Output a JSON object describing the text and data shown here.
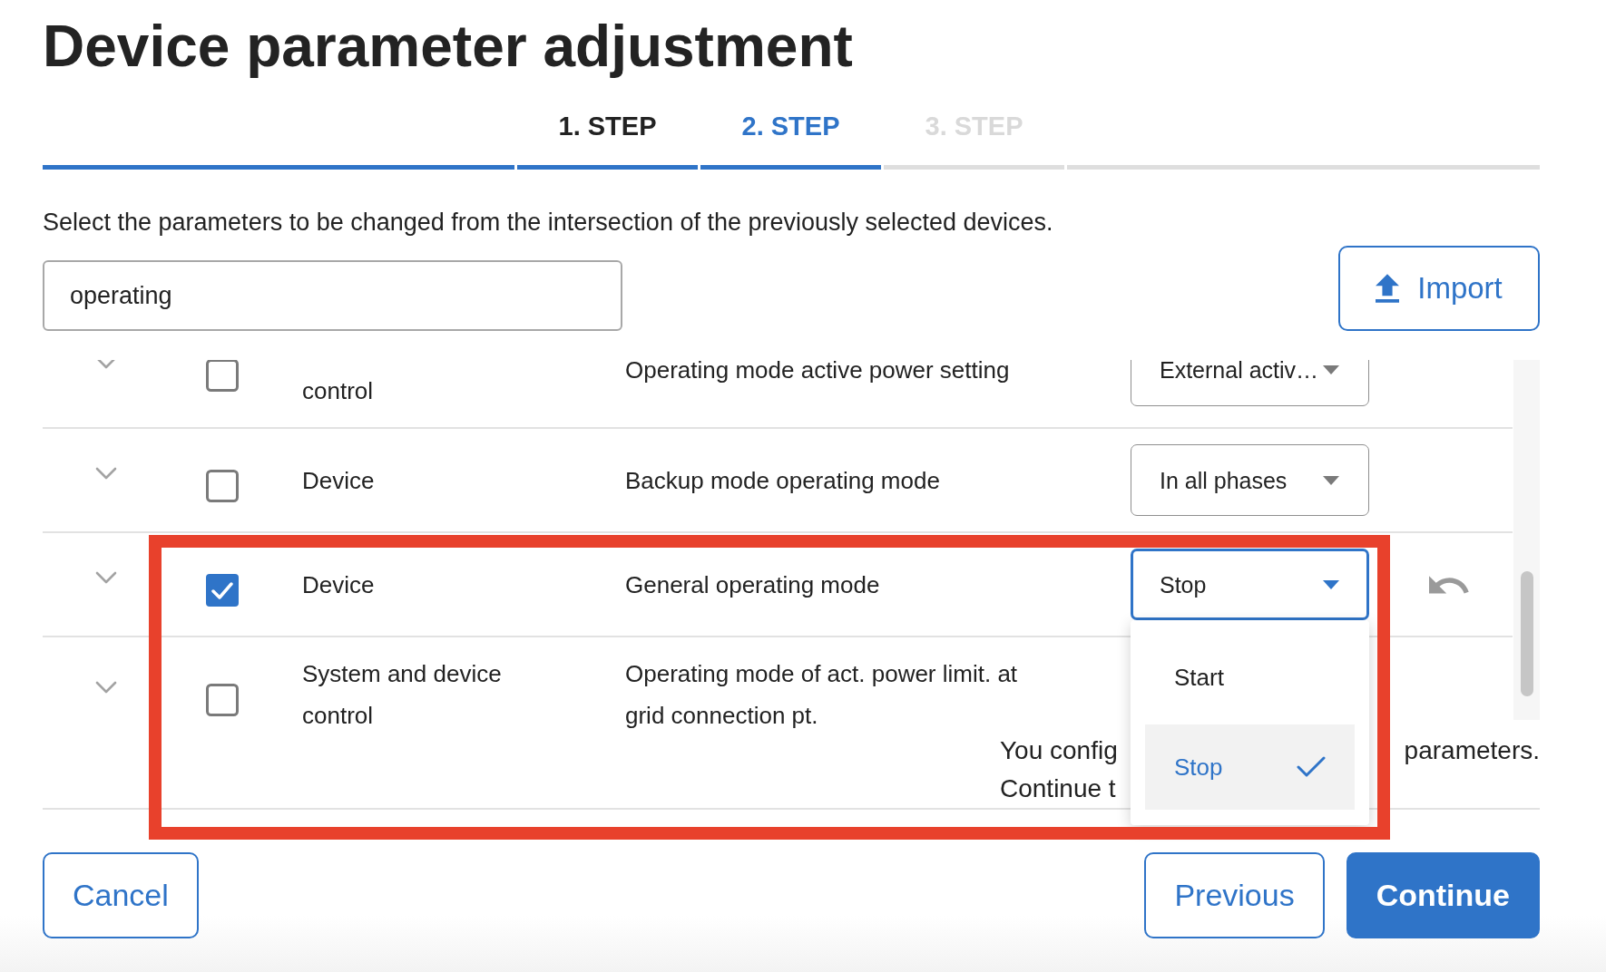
{
  "title": "Device parameter adjustment",
  "steps": [
    {
      "label": "1. STEP",
      "completed": true,
      "selected": false
    },
    {
      "label": "2. STEP",
      "completed": false,
      "selected": true
    },
    {
      "label": "3. STEP",
      "completed": false,
      "selected": false
    }
  ],
  "instruction": "Select the parameters to be changed from the intersection of the previously selected devices.",
  "search": {
    "value": "operating"
  },
  "import_button": {
    "label": "Import"
  },
  "rows": [
    {
      "expanded": false,
      "checked": false,
      "category": "control",
      "parameter": "Operating mode active power setting",
      "select": {
        "value": "External activ…",
        "open": false
      },
      "changed": false
    },
    {
      "expanded": false,
      "checked": false,
      "category": "Device",
      "parameter": "Backup mode operating mode",
      "select": {
        "value": "In all phases",
        "open": false
      },
      "changed": false
    },
    {
      "expanded": false,
      "checked": true,
      "category": "Device",
      "parameter": "General operating mode",
      "select": {
        "value": "Stop",
        "open": true,
        "options": [
          {
            "label": "Start",
            "selected": false
          },
          {
            "label": "Stop",
            "selected": true
          }
        ]
      },
      "changed": true
    },
    {
      "expanded": false,
      "checked": false,
      "category": "System and device control",
      "parameter": "Operating mode of act. power limit. at grid connection pt.",
      "changed": false
    }
  ],
  "summary": {
    "lines": [
      {
        "parts": [
          "You config",
          "parameters."
        ]
      },
      {
        "parts": [
          "Continue t"
        ]
      }
    ]
  },
  "annotation": {
    "kind": "frame"
  },
  "footer": {
    "cancel": {
      "label": "Cancel"
    },
    "previous": {
      "label": "Previous"
    },
    "continue": {
      "label": "Continue"
    }
  }
}
